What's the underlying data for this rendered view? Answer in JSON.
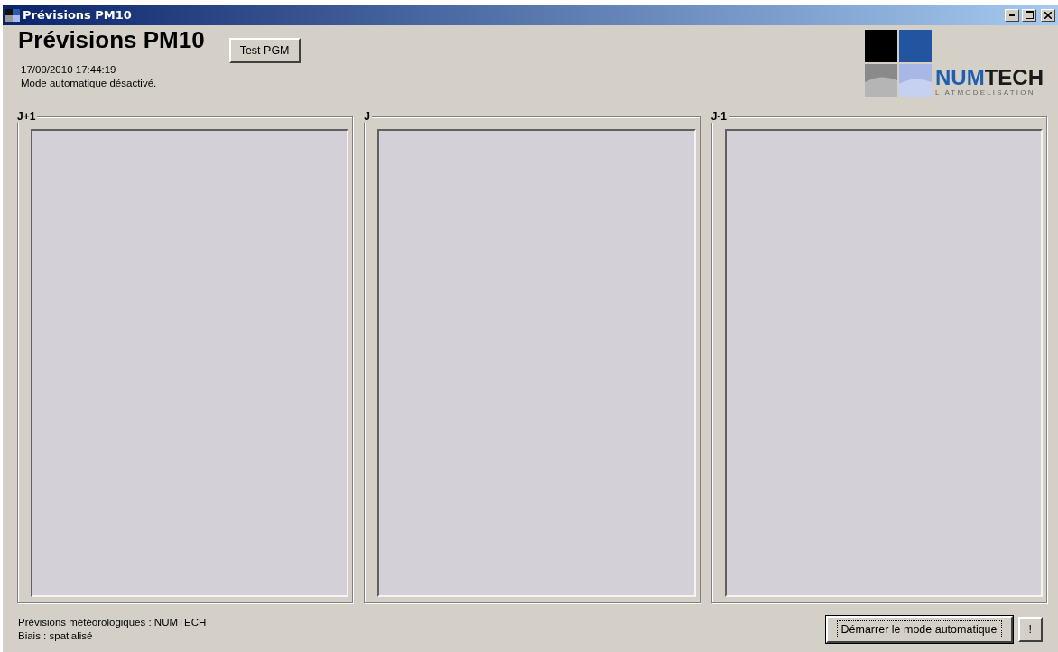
{
  "window": {
    "title": "Prévisions PM10"
  },
  "header": {
    "title": "Prévisions PM10",
    "timestamp": "17/09/2010 17:44:19",
    "status": "Mode automatique désactivé.",
    "test_button": "Test PGM"
  },
  "logo": {
    "name": "NUMTECH",
    "tagline": "L'ATMODELISATION"
  },
  "panels": [
    {
      "label": "J+1"
    },
    {
      "label": "J"
    },
    {
      "label": "J-1"
    }
  ],
  "footer": {
    "lines": [
      "Prévisions météorologiques : NUMTECH",
      "Biais : spatialisé"
    ],
    "buttons": [
      {
        "label": "Démarrer le mode automatique",
        "focused": true
      },
      {
        "label": "!",
        "focused": false
      }
    ]
  }
}
